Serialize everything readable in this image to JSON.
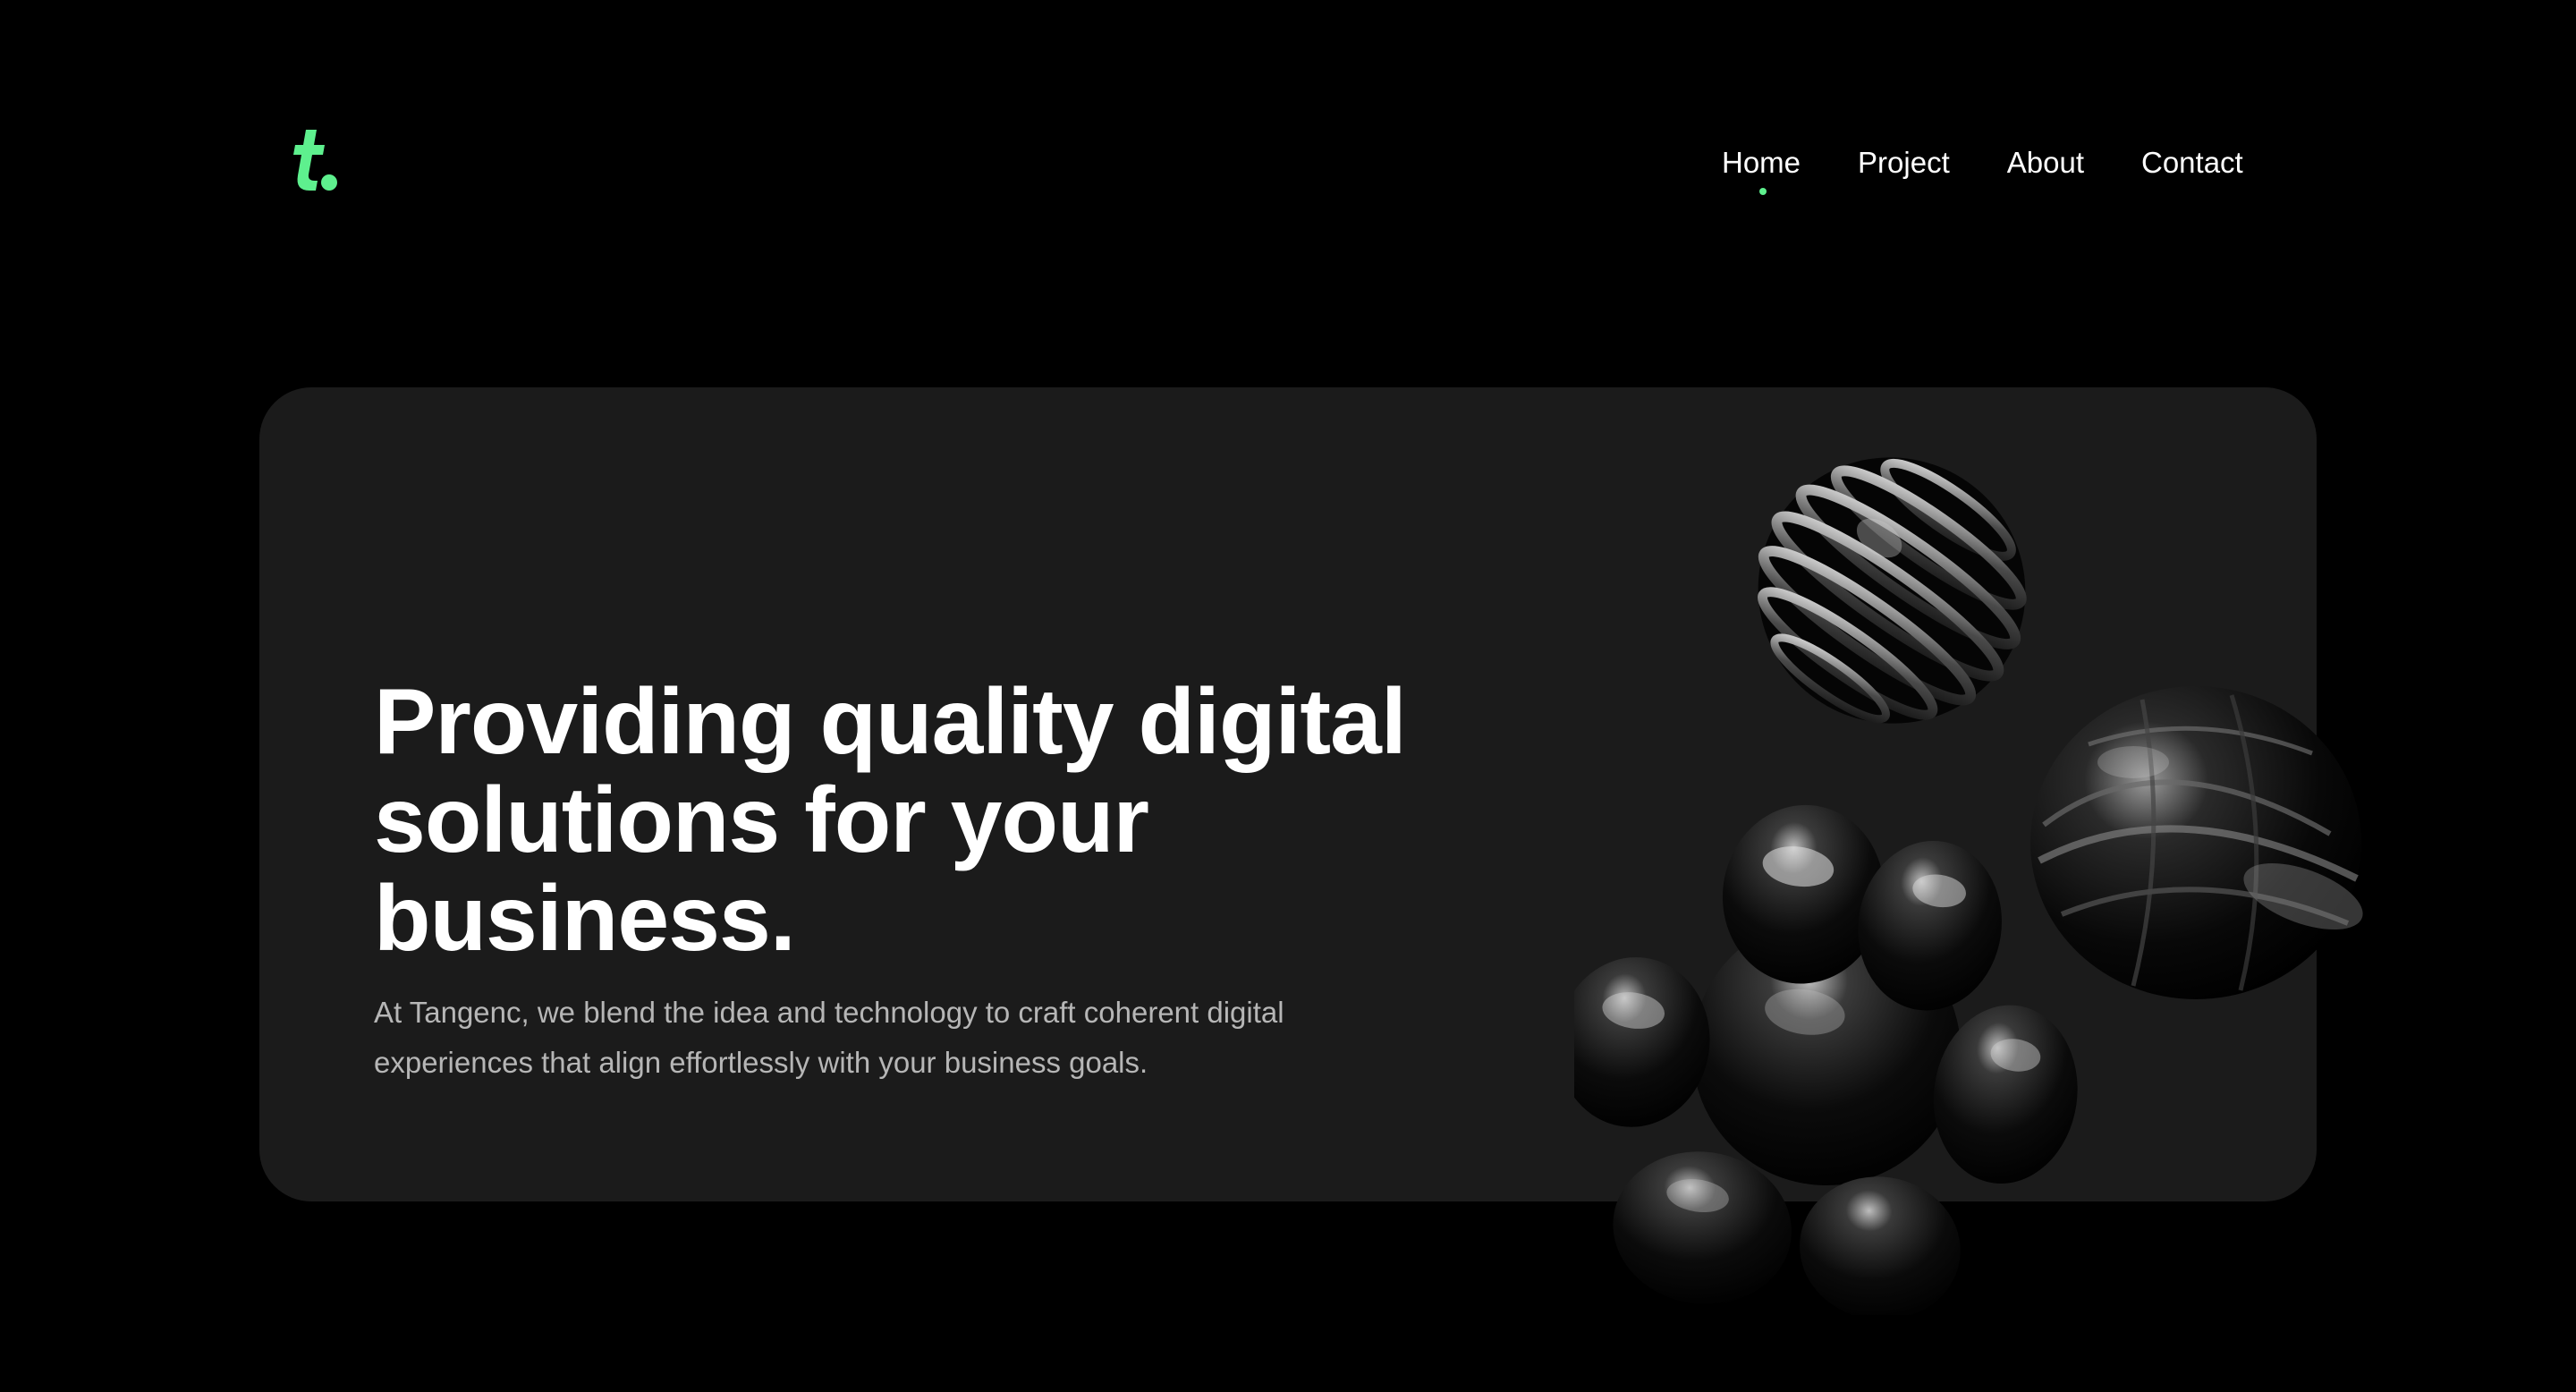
{
  "brand": {
    "logo_text": "t.",
    "accent_color": "#5ef08e"
  },
  "nav": {
    "items": [
      {
        "label": "Home",
        "active": true
      },
      {
        "label": "Project",
        "active": false
      },
      {
        "label": "About",
        "active": false
      },
      {
        "label": "Contact",
        "active": false
      }
    ]
  },
  "hero": {
    "title": "Providing quality digital solutions for your business.",
    "subtitle": "At Tangenc, we blend the idea and technology to craft coherent digital experiences that align effortlessly with your business goals."
  },
  "decor": {
    "shapes": [
      "ribbed-sphere",
      "twisted-sphere",
      "cross-blob"
    ]
  }
}
